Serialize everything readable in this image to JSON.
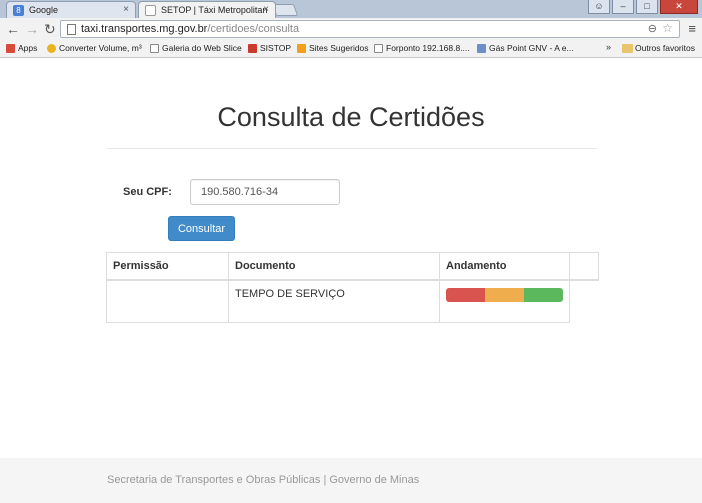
{
  "browser": {
    "tabs": [
      {
        "title": "Google",
        "favicon": "google-g-icon",
        "favicon_color": "#4a7fd6",
        "favicon_char": "8"
      },
      {
        "title": "SETOP | Táxi Metropolitan",
        "favicon": "page-icon",
        "favicon_color": "#ffffff",
        "favicon_char": ""
      }
    ],
    "url_host": "taxi.transportes.mg.gov.br",
    "url_path": "/certidoes/consulta",
    "bookmarks": [
      {
        "label": "Apps",
        "icon": "apps-grid-icon",
        "color": "#d94a3a"
      },
      {
        "label": "Converter Volume, m³",
        "icon": "converter-icon",
        "color": "#e8b320"
      },
      {
        "label": "Galeria do Web Slice",
        "icon": "page-icon",
        "color": "#ffffff"
      },
      {
        "label": "SISTOP",
        "icon": "sistop-icon",
        "color": "#c93b2f"
      },
      {
        "label": "Sites Sugeridos",
        "icon": "suggested-sites-icon",
        "color": "#f0a020"
      },
      {
        "label": "Forponto 192.168.8....",
        "icon": "page-icon",
        "color": "#ffffff"
      },
      {
        "label": "Gás Point GNV - A e...",
        "icon": "gas-point-icon",
        "color": "#6a8fc9"
      }
    ],
    "bookmarks_more": "»",
    "other_bookmarks": "Outros favoritos"
  },
  "page": {
    "title": "Consulta de Certidões",
    "cpf_label": "Seu CPF:",
    "cpf_value": "190.580.716-34",
    "submit_label": "Consultar",
    "table": {
      "headers": [
        "Permissão",
        "Documento",
        "Andamento"
      ],
      "rows": [
        {
          "permissao": "",
          "documento": "TEMPO DE SERVIÇO",
          "andamento": [
            {
              "color": "#d9534f",
              "fraction": 0.333
            },
            {
              "color": "#f0ad4e",
              "fraction": 0.333
            },
            {
              "color": "#5cb85c",
              "fraction": 0.334
            }
          ]
        }
      ]
    },
    "footer": "Secretaria de Transportes e Obras Públicas | Governo de Minas"
  }
}
